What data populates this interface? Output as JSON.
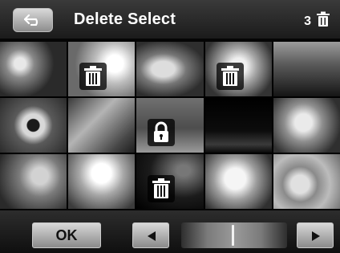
{
  "header": {
    "title": "Delete Select",
    "selected_count": "3",
    "icons": {
      "back": "back-arrow-icon",
      "trash": "trash-icon"
    }
  },
  "footer": {
    "ok_label": "OK",
    "icons": {
      "prev": "triangle-left-icon",
      "next": "triangle-right-icon"
    },
    "scroll_position": 0.5
  },
  "thumbnails": [
    {
      "id": 1,
      "state": "normal"
    },
    {
      "id": 2,
      "state": "delete_marked"
    },
    {
      "id": 3,
      "state": "normal"
    },
    {
      "id": 4,
      "state": "delete_marked"
    },
    {
      "id": 5,
      "state": "normal"
    },
    {
      "id": 6,
      "state": "normal"
    },
    {
      "id": 7,
      "state": "normal"
    },
    {
      "id": 8,
      "state": "protected"
    },
    {
      "id": 9,
      "state": "normal"
    },
    {
      "id": 10,
      "state": "normal"
    },
    {
      "id": 11,
      "state": "normal"
    },
    {
      "id": 12,
      "state": "normal"
    },
    {
      "id": 13,
      "state": "delete_marked"
    },
    {
      "id": 14,
      "state": "normal"
    },
    {
      "id": 15,
      "state": "normal"
    }
  ]
}
